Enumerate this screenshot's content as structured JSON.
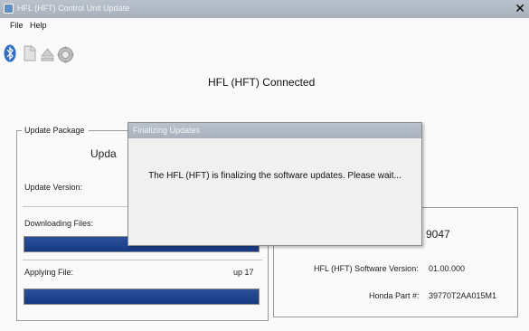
{
  "window": {
    "title": "HFL (HFT) Control Unit Update"
  },
  "menu": {
    "file": "File",
    "help": "Help"
  },
  "toolbar": {
    "icons": [
      "bluetooth-icon",
      "document-icon",
      "eject-icon",
      "gear-icon"
    ]
  },
  "status": {
    "connected": "HFL (HFT) Connected"
  },
  "update_package": {
    "group_label": "Update Package",
    "header_partial": "Upda",
    "version_label": "Update Version:"
  },
  "downloading": {
    "label": "Downloading Files:",
    "progress": 1.0
  },
  "applying": {
    "label": "Applying File:",
    "file": "up 17",
    "progress": 1.0
  },
  "device": {
    "id_partial": "9047",
    "software_version_label": "HFL (HFT) Software Version:",
    "software_version": "01.00.000",
    "part_label": "Honda Part #:",
    "part_number": "39770T2AA015M1"
  },
  "dialog": {
    "title": "Finalizing Updates",
    "message": "The HFL (HFT) is finalizing the software updates. Please wait..."
  },
  "colors": {
    "progress": "#1d438e",
    "titlebar": "#aeb7c2"
  }
}
